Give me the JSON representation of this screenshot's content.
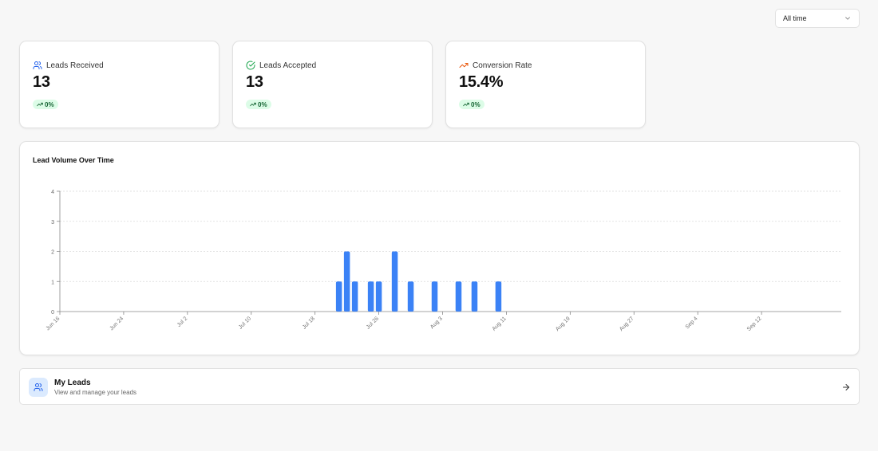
{
  "filter": {
    "selected": "All time"
  },
  "stats": [
    {
      "label": "Leads Received",
      "value": "13",
      "change": "0%",
      "icon": "users-icon",
      "icon_color": "#2563eb"
    },
    {
      "label": "Leads Accepted",
      "value": "13",
      "change": "0%",
      "icon": "check-circle-icon",
      "icon_color": "#16a34a"
    },
    {
      "label": "Conversion Rate",
      "value": "15.4%",
      "change": "0%",
      "icon": "trending-up-icon",
      "icon_color": "#ea580c"
    }
  ],
  "colors": {
    "bar": "#3b82f6",
    "badge_bg": "#dcfce7",
    "badge_text": "#166534"
  },
  "chart_data": {
    "type": "bar",
    "title": "Lead Volume Over Time",
    "xlabel": "",
    "ylabel": "",
    "ylim": [
      0,
      4
    ],
    "yticks": [
      0,
      1,
      2,
      3,
      4
    ],
    "grid": true,
    "x_range": [
      "2025-06-16",
      "2025-09-22"
    ],
    "xticks": [
      {
        "date": "2025-06-16",
        "label": "Jun 16"
      },
      {
        "date": "2025-06-24",
        "label": "Jun 24"
      },
      {
        "date": "2025-07-02",
        "label": "Jul 2"
      },
      {
        "date": "2025-07-10",
        "label": "Jul 10"
      },
      {
        "date": "2025-07-18",
        "label": "Jul 18"
      },
      {
        "date": "2025-07-26",
        "label": "Jul 26"
      },
      {
        "date": "2025-08-03",
        "label": "Aug 3"
      },
      {
        "date": "2025-08-11",
        "label": "Aug 11"
      },
      {
        "date": "2025-08-19",
        "label": "Aug 19"
      },
      {
        "date": "2025-08-27",
        "label": "Aug 27"
      },
      {
        "date": "2025-09-04",
        "label": "Sep 4"
      },
      {
        "date": "2025-09-12",
        "label": "Sep 12"
      }
    ],
    "points": [
      {
        "date": "2025-07-21",
        "value": 1
      },
      {
        "date": "2025-07-22",
        "value": 2
      },
      {
        "date": "2025-07-23",
        "value": 1
      },
      {
        "date": "2025-07-25",
        "value": 1
      },
      {
        "date": "2025-07-26",
        "value": 1
      },
      {
        "date": "2025-07-28",
        "value": 2
      },
      {
        "date": "2025-07-30",
        "value": 1
      },
      {
        "date": "2025-08-02",
        "value": 1
      },
      {
        "date": "2025-08-05",
        "value": 1
      },
      {
        "date": "2025-08-07",
        "value": 1
      },
      {
        "date": "2025-08-10",
        "value": 1
      }
    ]
  },
  "my_leads": {
    "title": "My Leads",
    "subtitle": "View and manage your leads"
  }
}
